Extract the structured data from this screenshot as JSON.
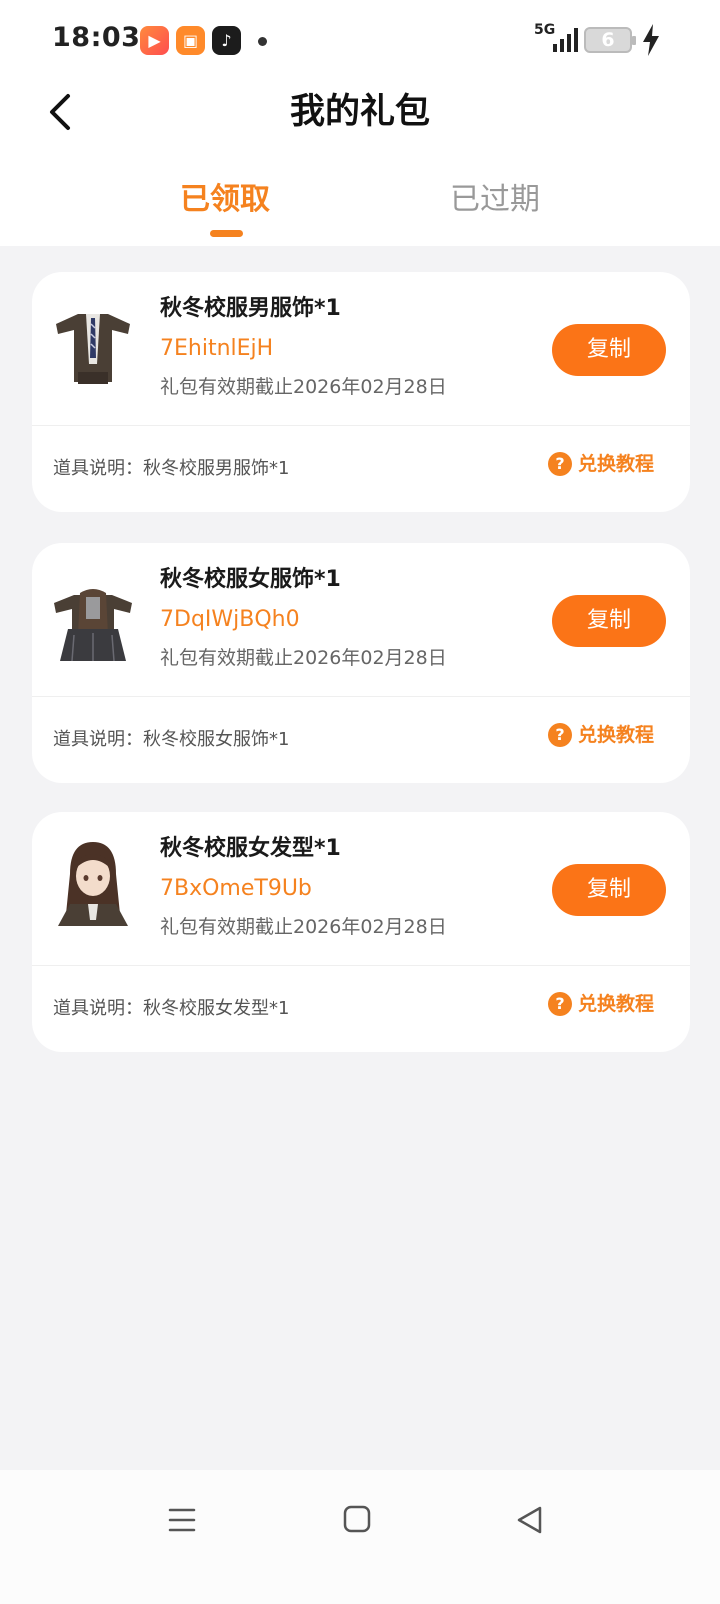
{
  "status_bar": {
    "time": "18:03",
    "network": "5G",
    "battery": "6",
    "app_icons": [
      "kuaishou-icon",
      "video-app-icon",
      "douyin-icon"
    ]
  },
  "header": {
    "title": "我的礼包",
    "back_icon": "chevron-left-icon"
  },
  "tabs": [
    {
      "label": "已领取",
      "active": true
    },
    {
      "label": "已过期",
      "active": false
    }
  ],
  "gifts": [
    {
      "name": "秋冬校服男服饰*1",
      "code": "7EhitnlEjH",
      "expiry": "礼包有效期截止2026年02月28日",
      "copy_label": "复制",
      "desc_label": "道具说明：",
      "desc_value": "秋冬校服男服饰*1",
      "tutorial_label": "兑换教程"
    },
    {
      "name": "秋冬校服女服饰*1",
      "code": "7DqIWjBQh0",
      "expiry": "礼包有效期截止2026年02月28日",
      "copy_label": "复制",
      "desc_label": "道具说明：",
      "desc_value": "秋冬校服女服饰*1",
      "tutorial_label": "兑换教程"
    },
    {
      "name": "秋冬校服女发型*1",
      "code": "7BxOmeT9Ub",
      "expiry": "礼包有效期截止2026年02月28日",
      "copy_label": "复制",
      "desc_label": "道具说明：",
      "desc_value": "秋冬校服女发型*1",
      "tutorial_label": "兑换教程"
    }
  ],
  "colors": {
    "accent": "#f5821f",
    "button": "#fb7417",
    "background": "#f3f3f5"
  },
  "system_nav": [
    "menu-icon",
    "home-icon",
    "back-triangle-icon"
  ]
}
